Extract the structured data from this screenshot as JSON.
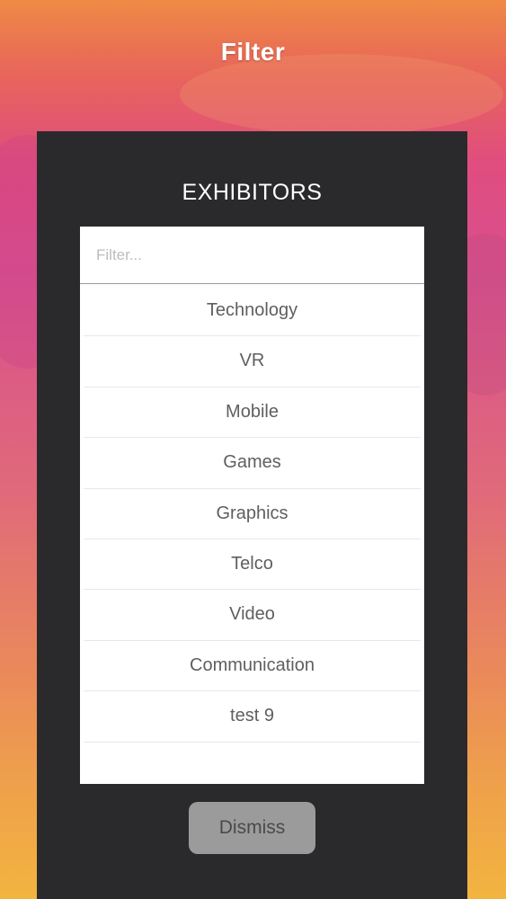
{
  "header": {
    "title": "Filter"
  },
  "dialog": {
    "title": "EXHIBITORS",
    "filter_placeholder": "Filter...",
    "items": [
      {
        "label": "Technology"
      },
      {
        "label": "VR"
      },
      {
        "label": "Mobile"
      },
      {
        "label": "Games"
      },
      {
        "label": "Graphics"
      },
      {
        "label": "Telco"
      },
      {
        "label": "Video"
      },
      {
        "label": "Communication"
      },
      {
        "label": "test 9"
      }
    ],
    "dismiss_label": "Dismiss"
  },
  "colors": {
    "dialog_bg": "#2a2a2c",
    "dismiss_bg": "#9b9b9b",
    "gradient_top": "#ee8a45",
    "gradient_bottom": "#f2b440"
  }
}
